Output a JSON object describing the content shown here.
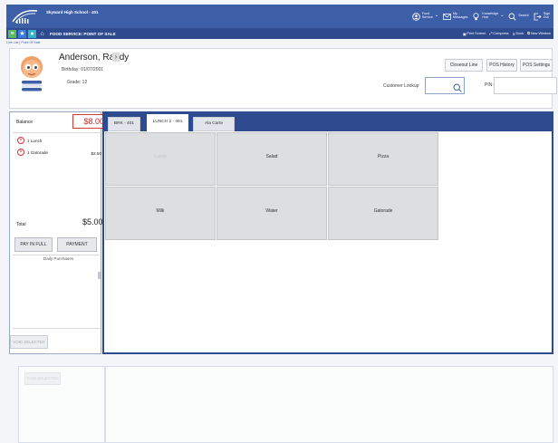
{
  "header": {
    "school": "Skyward High School - 401",
    "items": [
      {
        "label1": "Food",
        "label2": "Service",
        "icon": "food-service-icon"
      },
      {
        "label1": "My",
        "label2": "Messages",
        "icon": "mail-icon"
      },
      {
        "label1": "Knowledge",
        "label2": "Hub",
        "icon": "lightbulb-icon"
      },
      {
        "label1": "Search",
        "label2": "",
        "icon": "search-icon"
      },
      {
        "label1": "Sign",
        "label2": "Out",
        "icon": "sign-out-icon"
      }
    ]
  },
  "subbar": {
    "title": "FOOD SERVICE: POINT OF SALE",
    "actions": [
      "Print Screen",
      "Compress",
      "Dock",
      "New Window"
    ]
  },
  "breadcrumb": "Line List  |  Point Of Sale",
  "student": {
    "name": "Anderson, Randy",
    "birthday": "Birthday:  01/07/2001",
    "grade": "Grade:  12"
  },
  "buttons": {
    "closeout": "Closeout Line",
    "history": "POS History",
    "settings": "POS Settings"
  },
  "lookup": {
    "label": "Customer Lookup",
    "pin_label": "PIN:",
    "value": "",
    "pin_value": ""
  },
  "left": {
    "balance_label": "Balance",
    "balance_value": "$8.00",
    "items": [
      {
        "label": "1 Lunch",
        "price": ""
      },
      {
        "label": "1 Gatorade",
        "price": "$2.50"
      }
    ],
    "total_label": "Total",
    "total_value": "$5.00",
    "pay_in_full": "PAY IN FULL",
    "payment": "PAYMENT",
    "daily_purchases": "Daily Purchases",
    "void_selected": "VOID SELECTED"
  },
  "tabs": [
    "BRK - 401",
    "LUNCH 2 - 401",
    "Ala Carte"
  ],
  "active_tab": 1,
  "tiles": [
    {
      "label": "Lunch",
      "disabled": true
    },
    {
      "label": "Salad",
      "disabled": false
    },
    {
      "label": "Pizza",
      "disabled": false
    },
    {
      "label": "Milk",
      "disabled": false
    },
    {
      "label": "Water",
      "disabled": false
    },
    {
      "label": "Gatorade",
      "disabled": false
    }
  ],
  "lower": {
    "void_selected": "VOID SELECTED"
  },
  "colors": {
    "header_bg": "#3c5fa8",
    "subbar_bg": "#2f4b8f",
    "balance_red": "#d23a3a"
  }
}
